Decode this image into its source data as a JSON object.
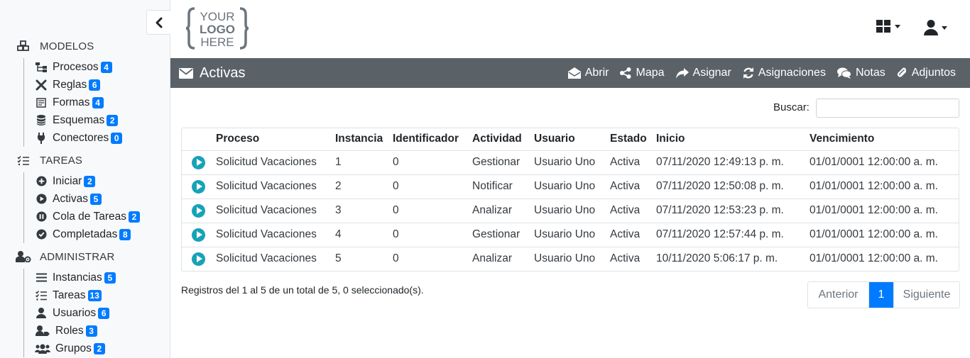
{
  "header": {
    "logo": {
      "line1": "YOUR",
      "line2": "LOGO",
      "line3": "HERE"
    }
  },
  "sidebar": {
    "sections": [
      {
        "title": "MODELOS",
        "icon": "cubes-icon",
        "items": [
          {
            "label": "Procesos",
            "count": "4",
            "icon": "sitemap-icon"
          },
          {
            "label": "Reglas",
            "count": "6",
            "icon": "tools-icon"
          },
          {
            "label": "Formas",
            "count": "4",
            "icon": "form-icon"
          },
          {
            "label": "Esquemas",
            "count": "2",
            "icon": "database-icon"
          },
          {
            "label": "Conectores",
            "count": "0",
            "icon": "plug-icon"
          }
        ]
      },
      {
        "title": "TAREAS",
        "icon": "tasks-icon",
        "items": [
          {
            "label": "Iniciar",
            "count": "2",
            "icon": "plus-circle-icon"
          },
          {
            "label": "Activas",
            "count": "5",
            "icon": "play-circle-icon"
          },
          {
            "label": "Cola de Tareas",
            "count": "2",
            "icon": "pause-circle-icon"
          },
          {
            "label": "Completadas",
            "count": "8",
            "icon": "check-circle-icon"
          }
        ]
      },
      {
        "title": "ADMINISTRAR",
        "icon": "user-cog-icon",
        "items": [
          {
            "label": "Instancias",
            "count": "5",
            "icon": "list-icon"
          },
          {
            "label": "Tareas",
            "count": "13",
            "icon": "tasks-icon"
          },
          {
            "label": "Usuarios",
            "count": "6",
            "icon": "user-icon"
          },
          {
            "label": "Roles",
            "count": "3",
            "icon": "user-tag-icon"
          },
          {
            "label": "Grupos",
            "count": "2",
            "icon": "users-icon"
          }
        ]
      }
    ]
  },
  "titlebar": {
    "title": "Activas",
    "actions": [
      {
        "label": "Abrir",
        "icon": "envelope-open-icon"
      },
      {
        "label": "Mapa",
        "icon": "share-alt-icon"
      },
      {
        "label": "Asignar",
        "icon": "share-icon"
      },
      {
        "label": "Asignaciones",
        "icon": "sync-icon"
      },
      {
        "label": "Notas",
        "icon": "comments-icon"
      },
      {
        "label": "Adjuntos",
        "icon": "paperclip-icon"
      }
    ]
  },
  "search": {
    "label": "Buscar:",
    "value": ""
  },
  "table": {
    "columns": [
      "Proceso",
      "Instancia",
      "Identificador",
      "Actividad",
      "Usuario",
      "Estado",
      "Inicio",
      "Vencimiento"
    ],
    "rows": [
      [
        "Solicitud Vacaciones",
        "1",
        "0",
        "Gestionar",
        "Usuario Uno",
        "Activa",
        "07/11/2020 12:49:13 p. m.",
        "01/01/0001 12:00:00 a. m."
      ],
      [
        "Solicitud Vacaciones",
        "2",
        "0",
        "Notificar",
        "Usuario Uno",
        "Activa",
        "07/11/2020 12:50:08 p. m.",
        "01/01/0001 12:00:00 a. m."
      ],
      [
        "Solicitud Vacaciones",
        "3",
        "0",
        "Analizar",
        "Usuario Uno",
        "Activa",
        "07/11/2020 12:53:23 p. m.",
        "01/01/0001 12:00:00 a. m."
      ],
      [
        "Solicitud Vacaciones",
        "4",
        "0",
        "Gestionar",
        "Usuario Uno",
        "Activa",
        "07/11/2020 12:57:44 p. m.",
        "01/01/0001 12:00:00 a. m."
      ],
      [
        "Solicitud Vacaciones",
        "5",
        "0",
        "Analizar",
        "Usuario Uno",
        "Activa",
        "10/11/2020 5:06:17 p. m.",
        "01/01/0001 12:00:00 a. m."
      ]
    ]
  },
  "footer": {
    "info": "Registros del 1 al 5 de un total de 5, 0 seleccionado(s).",
    "pager": {
      "prev": "Anterior",
      "current": "1",
      "next": "Siguiente"
    }
  },
  "colors": {
    "accent": "#007bff",
    "titlebar": "#5a6268",
    "play": "#17a2b8"
  }
}
